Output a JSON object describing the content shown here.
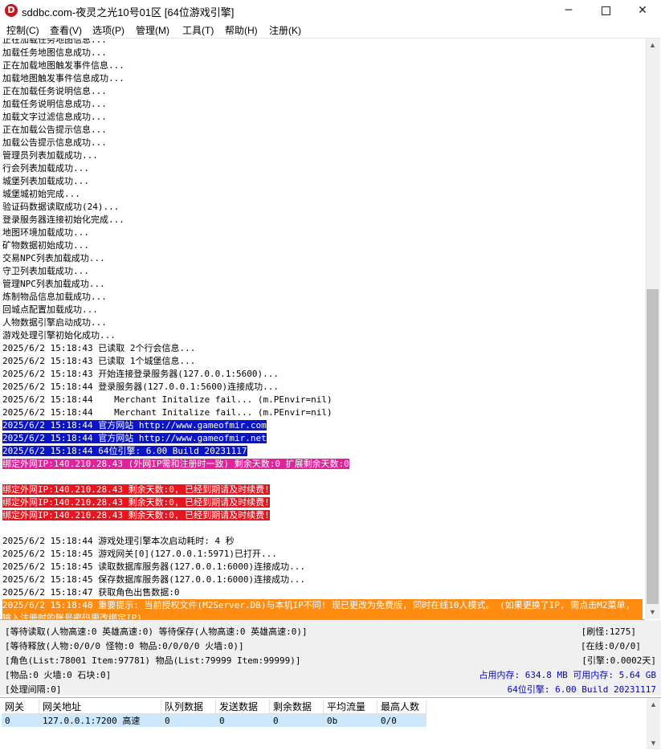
{
  "window": {
    "title": "sddbc.com-夜灵之光10号01区 [64位游戏引擎]",
    "icon_letter": "D",
    "minimize": "─",
    "close": "✕"
  },
  "menu": [
    {
      "label": "控制(C)"
    },
    {
      "label": "查看(V)"
    },
    {
      "label": "选项(P)"
    },
    {
      "label": "管理(M)"
    },
    {
      "label": "工具(T)"
    },
    {
      "label": "帮助(H)"
    },
    {
      "label": "注册(K)"
    }
  ],
  "log": [
    {
      "text": "正在加载任务地图信息...",
      "style": ""
    },
    {
      "text": "加载任务地图信息成功...",
      "style": ""
    },
    {
      "text": "正在加载地图触发事件信息...",
      "style": ""
    },
    {
      "text": "加载地图触发事件信息成功...",
      "style": ""
    },
    {
      "text": "正在加载任务说明信息...",
      "style": ""
    },
    {
      "text": "加载任务说明信息成功...",
      "style": ""
    },
    {
      "text": "加载文字过滤信息成功...",
      "style": ""
    },
    {
      "text": "正在加载公告提示信息...",
      "style": ""
    },
    {
      "text": "加载公告提示信息成功...",
      "style": ""
    },
    {
      "text": "管理员列表加载成功...",
      "style": ""
    },
    {
      "text": "行会列表加载成功...",
      "style": ""
    },
    {
      "text": "城堡列表加载成功...",
      "style": ""
    },
    {
      "text": "城堡城初始完成...",
      "style": ""
    },
    {
      "text": "验证码数据读取成功(24)...",
      "style": ""
    },
    {
      "text": "登录服务器连接初始化完成...",
      "style": ""
    },
    {
      "text": "地图环境加载成功...",
      "style": ""
    },
    {
      "text": "矿物数据初始成功...",
      "style": ""
    },
    {
      "text": "交易NPC列表加载成功...",
      "style": ""
    },
    {
      "text": "守卫列表加载成功...",
      "style": ""
    },
    {
      "text": "管理NPC列表加载成功...",
      "style": ""
    },
    {
      "text": "炼制物品信息加载成功...",
      "style": ""
    },
    {
      "text": "回城点配置加载成功...",
      "style": ""
    },
    {
      "text": "人物数据引擎启动成功...",
      "style": ""
    },
    {
      "text": "游戏处理引擎初始化成功...",
      "style": ""
    },
    {
      "text": "2025/6/2 15:18:43 已读取 2个行会信息...",
      "style": ""
    },
    {
      "text": "2025/6/2 15:18:43 已读取 1个城堡信息...",
      "style": ""
    },
    {
      "text": "2025/6/2 15:18:43 开始连接登录服务器(127.0.0.1:5600)...",
      "style": ""
    },
    {
      "text": "2025/6/2 15:18:44 登录服务器(127.0.0.1:5600)连接成功...",
      "style": ""
    },
    {
      "text": "2025/6/2 15:18:44    Merchant Initalize fail... (m.PEnvir=nil)",
      "style": ""
    },
    {
      "text": "2025/6/2 15:18:44    Merchant Initalize fail... (m.PEnvir=nil)",
      "style": ""
    },
    {
      "text": "2025/6/2 15:18:44 官方网站 http://www.gameofmir.com",
      "style": "hl-blue"
    },
    {
      "text": "2025/6/2 15:18:44 官方网站 http://www.gameofmir.net",
      "style": "hl-blue"
    },
    {
      "text": "2025/6/2 15:18:44 64位引擎: 6.00 Build 20231117",
      "style": "hl-blue"
    },
    {
      "text": "绑定外网IP:140.210.28.43 (外网IP需和注册时一致) 剩余天数:0 扩展剩余天数:0",
      "style": "hl-pink"
    },
    {
      "text": "",
      "style": ""
    },
    {
      "text": "绑定外网IP:140.210.28.43 剩余天数:0, 已经到期请及时续费!",
      "style": "hl-red"
    },
    {
      "text": "绑定外网IP:140.210.28.43 剩余天数:0, 已经到期请及时续费!",
      "style": "hl-red"
    },
    {
      "text": "绑定外网IP:140.210.28.43 剩余天数:0, 已经到期请及时续费!",
      "style": "hl-red"
    },
    {
      "text": "",
      "style": ""
    },
    {
      "text": "2025/6/2 15:18:44 游戏处理引擎本次启动耗时: 4 秒",
      "style": ""
    },
    {
      "text": "2025/6/2 15:18:45 游戏网关[0](127.0.0.1:5971)已打开...",
      "style": ""
    },
    {
      "text": "2025/6/2 15:18:45 读取数据库服务器(127.0.0.1:6000)连接成功...",
      "style": ""
    },
    {
      "text": "2025/6/2 15:18:45 保存数据库服务器(127.0.0.1:6000)连接成功...",
      "style": ""
    },
    {
      "text": "2025/6/2 15:18:47 获取角色出售数据:0",
      "style": ""
    },
    {
      "text": "2025/6/2 15:18:48 重要提示: 当前授权文件(M2Server.DB)与本机IP不同! 现已更改为免费版, 同时在线10人模式。 (如果更换了IP, 需点击M2菜单,",
      "style": "hl-orange"
    },
    {
      "text": "输入注册时的账号密码更改绑定IP)",
      "style": "hl-orange"
    }
  ],
  "status": {
    "line1": "[等待读取(人物高速:0 英雄高速:0) 等待保存(人物高速:0 英雄高速:0)]",
    "line2": "[等待释放(人物:0/0/0 怪物:0 物品:0/0/0/0 火墙:0)]",
    "line3": "[角色(List:78001 Item:97781) 物品(List:79999 Item:99999)]",
    "line4": "[物品:0 火墙:0 石块:0]",
    "line5": "[处理间隔:0]",
    "right1": "[刷怪:1275]",
    "right2": "[在线:0/0/0]",
    "right3": "[引擎:0.0002天]",
    "right4": "占用内存: 634.8 MB 可用内存: 5.64 GB",
    "right5": "64位引擎: 6.00 Build 20231117"
  },
  "gateway": {
    "headers": [
      "网关",
      "网关地址",
      "队列数据",
      "发送数据",
      "剩余数据",
      "平均流量",
      "最高人数"
    ],
    "rows": [
      [
        "0",
        "127.0.0.1:7200 高速",
        "0",
        "0",
        "0",
        "0b",
        "0/0"
      ]
    ]
  },
  "colors": {
    "highlight_blue": "#0a14c8",
    "highlight_pink": "#e0239a",
    "highlight_red": "#e8141e",
    "highlight_orange": "#ff8c10",
    "memory_text": "#0000c8"
  }
}
